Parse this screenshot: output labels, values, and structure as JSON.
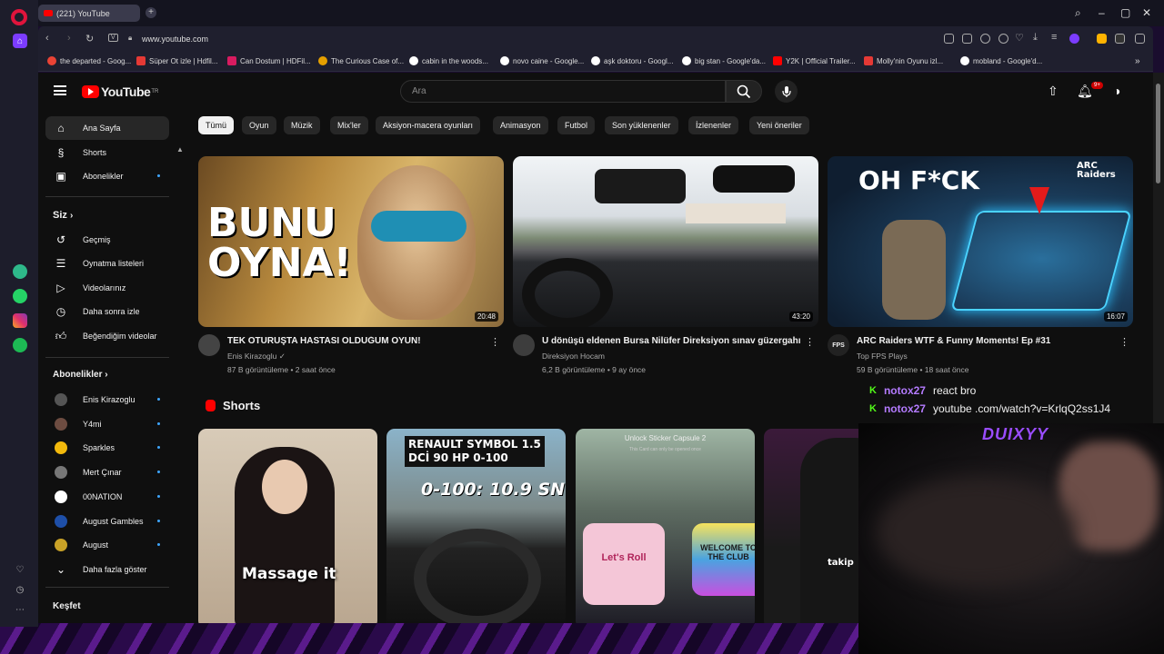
{
  "browser": {
    "tab_title": "(221) YouTube",
    "url": "www.youtube.com",
    "bookmarks": [
      "the departed - Goog...",
      "Süper Ot izle | Hdfil...",
      "Can Dostum | HDFil...",
      "The Curious Case of...",
      "cabin in the woods...",
      "novo caine - Google...",
      "aşk doktoru - Googl...",
      "big stan - Google'da...",
      "Y2K | Official Trailer...",
      "Molly'nin Oyunu izl...",
      "mobland - Google'd..."
    ]
  },
  "youtube": {
    "logo_text": "YouTube",
    "logo_region": "TR",
    "search_placeholder": "Ara",
    "notif_count": "9+",
    "sidebar": {
      "main": [
        "Ana Sayfa",
        "Shorts",
        "Abonelikler"
      ],
      "you_header": "Siz",
      "you_items": [
        "Geçmiş",
        "Oynatma listeleri",
        "Videolarınız",
        "Daha sonra izle",
        "Beğendiğim videolar"
      ],
      "subs_header": "Abonelikler",
      "subs": [
        "Enis Kirazoglu",
        "Y4mi",
        "Sparkles",
        "Mert Çınar",
        "00NATION",
        "August Gambles",
        "August"
      ],
      "more": "Daha fazla göster",
      "explore": "Keşfet"
    },
    "chips": [
      "Tümü",
      "Oyun",
      "Müzik",
      "Mix'ler",
      "Aksiyon-macera oyunları",
      "Animasyon",
      "Futbol",
      "Son yüklenenler",
      "İzlenenler",
      "Yeni öneriler"
    ],
    "videos": [
      {
        "title": "TEK OTURUŞTA HASTASI OLDUĞUM OYUN!",
        "channel": "Enis Kirazoglu",
        "stats": "87 B görüntüleme • 2 saat önce",
        "duration": "20:48",
        "thumb_text": "BUNU OYNA!"
      },
      {
        "title": "U dönüşü eldenen Bursa Nilüfer Direksiyon sınav güzergahı",
        "channel": "Direksiyon Hocam",
        "stats": "6,2 B görüntüleme • 9 ay önce",
        "duration": "43:20"
      },
      {
        "title": "ARC Raiders WTF & Funny Moments! Ep #31",
        "channel": "Top FPS Plays",
        "stats": "59 B görüntüleme • 18 saat önce",
        "duration": "16:07",
        "thumb_text": "OH F*CK",
        "brand": "ARC Raiders",
        "channel_avatar": "FPS"
      }
    ],
    "shorts_header": "Shorts",
    "shorts": [
      {
        "text": "Massage it"
      },
      {
        "text_line1": "RENAULT SYMBOL 1.5",
        "text_line2": "DCİ 90 HP 0-100",
        "text_line3": "0-100: 10.9 SN"
      },
      {
        "text_line1": "Unlock Sticker Capsule 2",
        "text_line2": "This Card can only be opened once",
        "sticker1": "Let's Roll",
        "sticker2": "WELCOME TO THE CLUB"
      },
      {
        "text": "takip"
      }
    ]
  },
  "overlay": {
    "chat": [
      {
        "user": "notox27",
        "message": "react bro"
      },
      {
        "user": "notox27",
        "message": "youtube .com/watch?v=KrlqQ2ss1J4"
      }
    ],
    "cam_name": "DUIXYY"
  }
}
